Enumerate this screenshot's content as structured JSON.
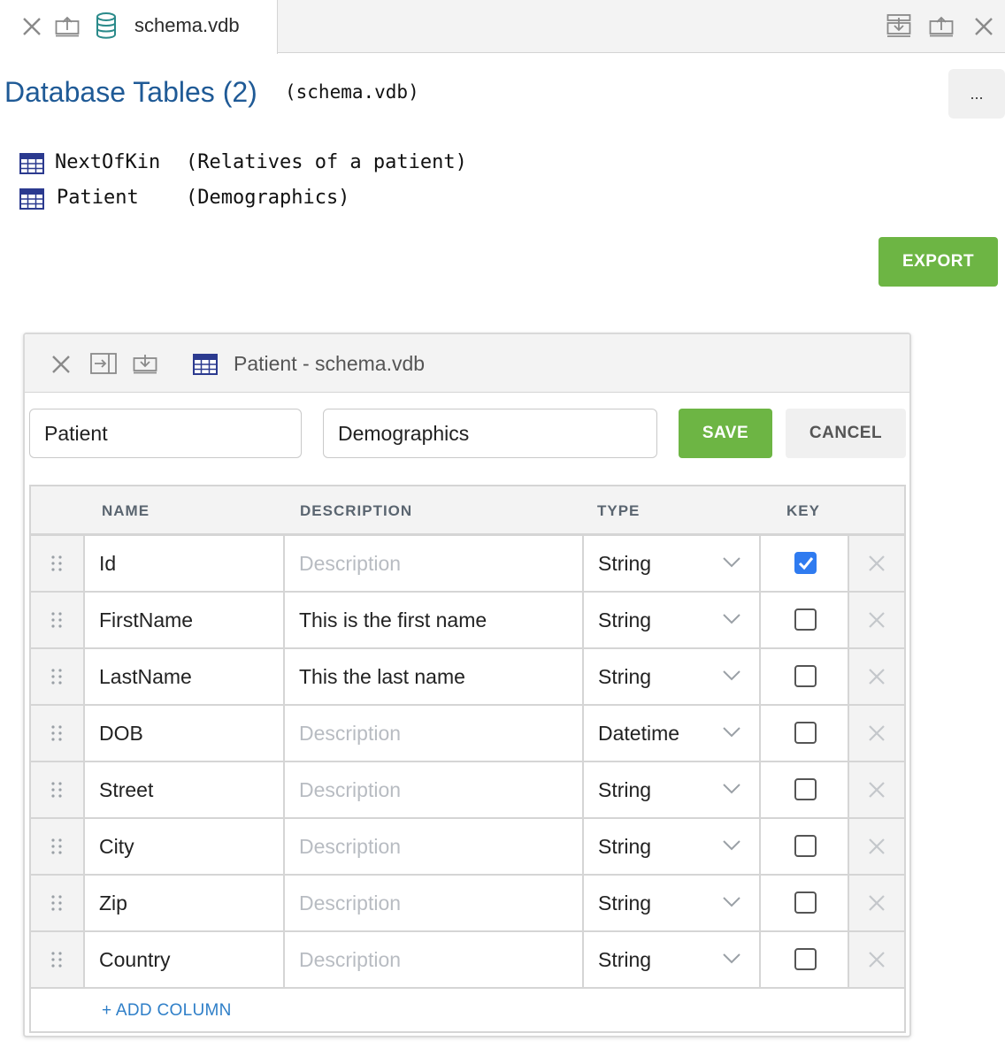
{
  "tabbar": {
    "tab_title": "schema.vdb",
    "icons": [
      "close-icon",
      "upload-icon",
      "database-icon",
      "download-all-icon",
      "upload-icon",
      "close-icon"
    ]
  },
  "header": {
    "title": "Database Tables (2)",
    "subtitle": "(schema.vdb)",
    "more_label": "..."
  },
  "tables": [
    {
      "name": "NextOfKin",
      "description": "(Relatives of a patient)"
    },
    {
      "name": "Patient",
      "description": "(Demographics)"
    }
  ],
  "export_label": "EXPORT",
  "panel": {
    "title": "Patient - schema.vdb",
    "name_value": "Patient",
    "description_value": "Demographics",
    "save_label": "SAVE",
    "cancel_label": "CANCEL",
    "columns_header": {
      "name": "NAME",
      "description": "DESCRIPTION",
      "type": "TYPE",
      "key": "KEY"
    },
    "description_placeholder": "Description",
    "rows": [
      {
        "name": "Id",
        "description": "",
        "type": "String",
        "key": true
      },
      {
        "name": "FirstName",
        "description": "This is the first name",
        "type": "String",
        "key": false
      },
      {
        "name": "LastName",
        "description": "This the last name",
        "type": "String",
        "key": false
      },
      {
        "name": "DOB",
        "description": "",
        "type": "Datetime",
        "key": false
      },
      {
        "name": "Street",
        "description": "",
        "type": "String",
        "key": false
      },
      {
        "name": "City",
        "description": "",
        "type": "String",
        "key": false
      },
      {
        "name": "Zip",
        "description": "",
        "type": "String",
        "key": false
      },
      {
        "name": "Country",
        "description": "",
        "type": "String",
        "key": false
      }
    ],
    "add_column_label": "+ ADD COLUMN"
  },
  "colors": {
    "title_blue": "#1f5a96",
    "green": "#6db544",
    "checkbox_blue": "#2f7bf0",
    "link_blue": "#2f7fc8"
  }
}
